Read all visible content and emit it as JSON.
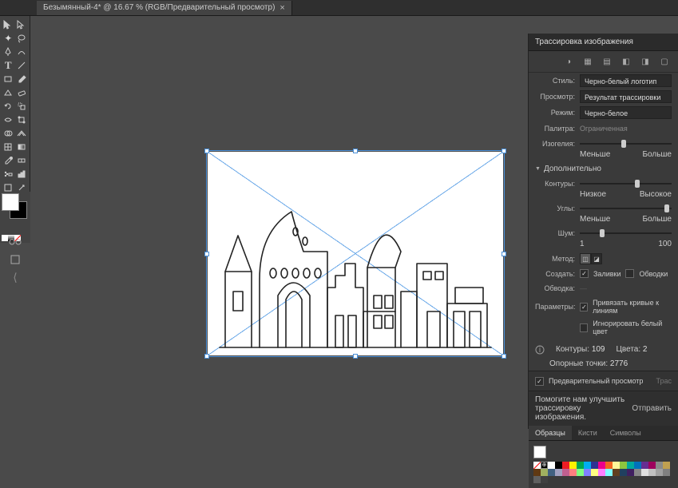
{
  "document": {
    "tab_title": "Безымянный-4* @ 16.67 % (RGB/Предварительный просмотр)"
  },
  "panel": {
    "title": "Трассировка изображения",
    "style_label": "Стиль:",
    "style_value": "Черно-белый логотип",
    "view_label": "Просмотр:",
    "view_value": "Результат трассировки",
    "mode_label": "Режим:",
    "mode_value": "Черно-белое",
    "palette_label": "Палитра:",
    "palette_value": "Ограниченная",
    "threshold_label": "Изогелия:",
    "threshold_min": "Меньше",
    "threshold_max": "Больше",
    "advanced_header": "Дополнительно",
    "paths_label": "Контуры:",
    "paths_min": "Низкое",
    "paths_max": "Высокое",
    "corners_label": "Углы:",
    "corners_min": "Меньше",
    "corners_max": "Больше",
    "noise_label": "Шум:",
    "noise_min": "1",
    "noise_max": "100",
    "method_label": "Метод:",
    "create_label": "Создать:",
    "fills_label": "Заливки",
    "strokes_label": "Обводки",
    "strokes_opt_label": "Обводка:",
    "options_label": "Параметры:",
    "snap_curves_label": "Привязать кривые к линиям",
    "ignore_white_label": "Игнорировать белый цвет",
    "info_paths_label": "Контуры:",
    "info_paths_value": "109",
    "info_colors_label": "Цвета:",
    "info_colors_value": "2",
    "info_anchors_label": "Опорные точки:",
    "info_anchors_value": "2776",
    "preview_label": "Предварительный просмотр",
    "trace_button": "Трас",
    "help_text": "Помогите нам улучшить трассировку изображения.",
    "help_link": "Отправить"
  },
  "swatches": {
    "tab1": "Образцы",
    "tab2": "Кисти",
    "tab3": "Символы"
  },
  "colors": [
    "#ffffff",
    "#000000",
    "#ed1c24",
    "#fff200",
    "#00a651",
    "#00aeef",
    "#2e3192",
    "#ec008c",
    "#f26522",
    "#fff799",
    "#8dc63f",
    "#00a99d",
    "#0072bc",
    "#662d91",
    "#9e005d",
    "#898989",
    "#c0a050",
    "#603913",
    "#a0b060",
    "#406080",
    "#a0a0c0",
    "#c06090",
    "#ff8080",
    "#80ff80",
    "#8080ff",
    "#ffff80",
    "#ff80ff",
    "#80ffff",
    "#604020",
    "#204060",
    "#402060",
    "#888888",
    "#e0e0e0",
    "#c0c0c0",
    "#a0a0a0",
    "#808080",
    "#606060",
    "#404040"
  ]
}
